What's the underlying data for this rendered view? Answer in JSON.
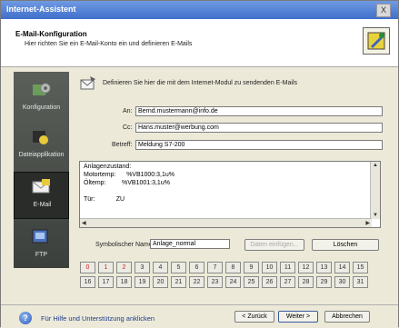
{
  "window": {
    "title": "Internet-Assistent",
    "close_glyph": "X"
  },
  "header": {
    "title": "E-Mail-Konfiguration",
    "subtitle": "Hier richten Sie ein E-Mail-Konto ein und definieren E-Mails"
  },
  "sidebar": {
    "items": [
      {
        "label": "Konfiguration",
        "icon": "gear-icon",
        "selected": false
      },
      {
        "label": "Dateiapplikation",
        "icon": "folder-icon",
        "selected": false
      },
      {
        "label": "E-Mail",
        "icon": "mail-icon",
        "selected": true
      },
      {
        "label": "FTP",
        "icon": "ftp-icon",
        "selected": false
      }
    ]
  },
  "content": {
    "intro": "Definieren Sie hier die mit dem Internet-Modul zu sendenden E-Mails",
    "fields": {
      "an_label": "An:",
      "an_value": "Bernd.mustermann@info.de",
      "cc_label": "Cc:",
      "cc_value": "Hans.muster@werbung.com",
      "betreff_label": "Betreff:",
      "betreff_value": "Meldung S7-200"
    },
    "body_lines": [
      "Anlagenzustand:",
      "Motortemp:      %VB1000:3,1u%",
      "Öltemp:         %VB1001:3,1u%",
      "Tür:            ZU"
    ],
    "symbolic_name_label": "Symbolischer Name:",
    "symbolic_name_value": "Anlage_normal",
    "insert_data_button": "Daten einfügen...",
    "delete_button": "Löschen",
    "numbers_row1": [
      "0",
      "1",
      "2",
      "3",
      "4",
      "5",
      "6",
      "7",
      "8",
      "9",
      "10",
      "11",
      "12",
      "13",
      "14",
      "15"
    ],
    "numbers_row2": [
      "16",
      "17",
      "18",
      "19",
      "20",
      "21",
      "22",
      "23",
      "24",
      "25",
      "26",
      "27",
      "28",
      "29",
      "30",
      "31"
    ],
    "active_numbers": [
      "0",
      "1",
      "2"
    ]
  },
  "footer": {
    "help_text": "Für Hilfe und Unterstützung anklicken",
    "back_button": "< Zurück",
    "next_button": "Weiter >",
    "cancel_button": "Abbrechen"
  },
  "colors": {
    "accent": "#3f6fcb",
    "active_number": "#d12020",
    "sidebar": "#4a4e4a"
  }
}
